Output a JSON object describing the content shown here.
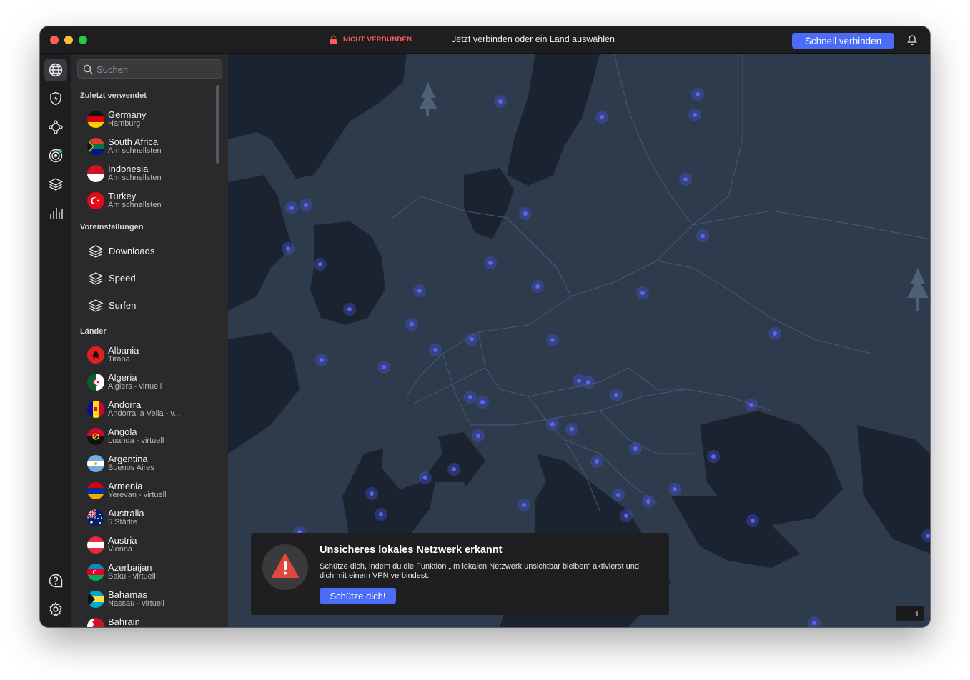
{
  "titlebar": {
    "status": "NICHT VERBUNDEN",
    "message": "Jetzt verbinden oder ein Land auswählen",
    "quick_connect": "Schnell verbinden"
  },
  "colors": {
    "accent": "#4b6cf7",
    "disconnected": "#ff5e57",
    "map_land": "#2e3b4c",
    "map_water": "#1a222d",
    "server_dot": "#4a57e8"
  },
  "rail": {
    "items": [
      "globe-icon",
      "shield-bolt-icon",
      "meshnet-icon",
      "target-icon",
      "layers-icon",
      "stats-icon"
    ],
    "bottom": [
      "help-icon",
      "gear-icon"
    ]
  },
  "search": {
    "placeholder": "Suchen"
  },
  "sections": {
    "recent": "Zuletzt verwendet",
    "presets": "Voreinstellungen",
    "countries": "Länder"
  },
  "recent": [
    {
      "name": "Germany",
      "sub": "Hamburg"
    },
    {
      "name": "South Africa",
      "sub": "Am schnellsten"
    },
    {
      "name": "Indonesia",
      "sub": "Am schnellsten"
    },
    {
      "name": "Turkey",
      "sub": "Am schnellsten"
    }
  ],
  "presets": [
    {
      "name": "Downloads"
    },
    {
      "name": "Speed"
    },
    {
      "name": "Surfen"
    }
  ],
  "countries": [
    {
      "name": "Albania",
      "sub": "Tirana"
    },
    {
      "name": "Algeria",
      "sub": "Algiers - virtuell"
    },
    {
      "name": "Andorra",
      "sub": "Andorra la Vella - v..."
    },
    {
      "name": "Angola",
      "sub": "Luanda - virtuell"
    },
    {
      "name": "Argentina",
      "sub": "Buenos Aires"
    },
    {
      "name": "Armenia",
      "sub": "Yerevan - virtuell"
    },
    {
      "name": "Australia",
      "sub": "5 Städte"
    },
    {
      "name": "Austria",
      "sub": "Vienna"
    },
    {
      "name": "Azerbaijan",
      "sub": "Baku - virtuell"
    },
    {
      "name": "Bahamas",
      "sub": "Nassau - virtuell"
    },
    {
      "name": "Bahrain",
      "sub": ""
    }
  ],
  "toast": {
    "title": "Unsicheres lokales Netzwerk erkannt",
    "body": "Schütze dich, indem du die Funktion „Im lokalen Netzwerk unsichtbar bleiben“ aktivierst und dich mit einem VPN verbindest.",
    "button": "Schütze dich!"
  },
  "zoom": {
    "minus": "−",
    "plus": "+"
  }
}
